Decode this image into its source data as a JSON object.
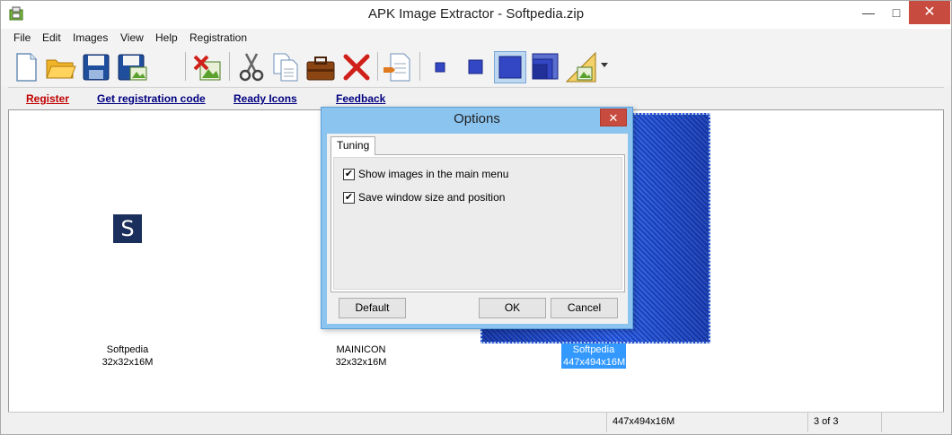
{
  "window": {
    "title": "APK Image Extractor - Softpedia.zip",
    "minimize": "—",
    "maximize": "□",
    "close": "✕"
  },
  "menu": [
    "File",
    "Edit",
    "Images",
    "View",
    "Help",
    "Registration"
  ],
  "links": {
    "register": "Register",
    "get_code": "Get registration code",
    "ready_icons": "Ready Icons",
    "feedback": "Feedback"
  },
  "thumbnails": [
    {
      "name": "Softpedia",
      "size": "32x32x16M",
      "glyph": "S"
    },
    {
      "name": "MAINICON",
      "size": "32x32x16M"
    },
    {
      "name": "Softpedia",
      "size": "447x494x16M",
      "selected": true
    }
  ],
  "status": {
    "dimensions": "447x494x16M",
    "position": "3 of 3"
  },
  "dialog": {
    "title": "Options",
    "close": "✕",
    "tab": "Tuning",
    "options": [
      {
        "label": "Show images in the main menu",
        "checked": true,
        "mark": "✔"
      },
      {
        "label": "Save window size and position",
        "checked": true,
        "mark": "✔"
      }
    ],
    "buttons": {
      "default": "Default",
      "ok": "OK",
      "cancel": "Cancel"
    }
  },
  "icons": [
    "new-icon",
    "open-folder-icon",
    "save-icon",
    "save-as-icon",
    "delete-image-icon",
    "cut-icon",
    "copy-icon",
    "paste-icon",
    "delete-icon",
    "properties-icon",
    "small-icon-view",
    "medium-icon-view",
    "large-icon-view",
    "cascade-view-icon",
    "stretch-view-icon"
  ],
  "colors": {
    "selection": "#3399ff",
    "link": "#000080",
    "register": "#c00000",
    "dialog_frame": "#8ac4ef",
    "close_button": "#c74b3f"
  }
}
